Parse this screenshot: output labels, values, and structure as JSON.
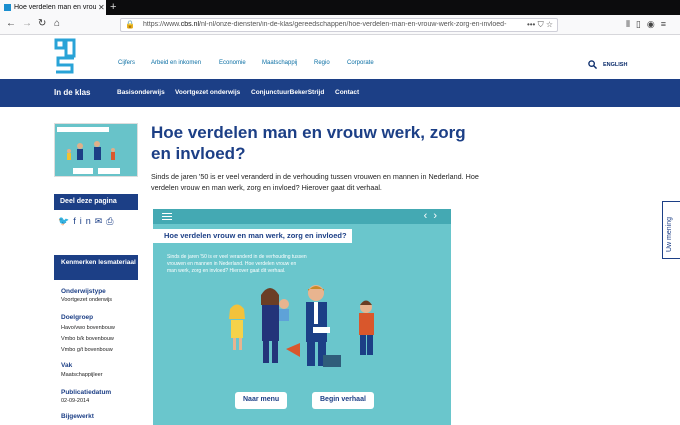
{
  "browser": {
    "tab_title": "Hoe verdelen man en vrouw wer",
    "url_prefix": "https://www.",
    "url_domain": "cbs.nl",
    "url_path": "/nl-nl/onze-diensten/in-de-klas/gereedschappen/hoe-verdelen-man-en-vrouw-werk-zorg-en-invloed-",
    "url_more": "•••"
  },
  "header": {
    "nav": [
      "Cijfers",
      "Arbeid en inkomen",
      "Economie",
      "Maatschappij",
      "Regio",
      "Corporate"
    ],
    "english": "ENGLISH"
  },
  "subnav": {
    "section": "In de klas",
    "items": [
      "Basisonderwijs",
      "Voortgezet onderwijs",
      "ConjunctuurBekerStrijd",
      "Contact"
    ]
  },
  "sidebar": {
    "share_label": "Deel deze pagina",
    "kenmerken_label": "Kenmerken lesmateriaal",
    "meta": [
      {
        "label": "Onderwijstype",
        "value": "Voortgezet onderwijs"
      },
      {
        "label": "Doelgroep",
        "value": "Havo/vwo bovenbouw\nVmbo b/k bovenbouw\nVmbo g/t bovenbouw"
      },
      {
        "label": "Vak",
        "value": "Maatschappijleer"
      },
      {
        "label": "Publicatiedatum",
        "value": "02-09-2014"
      },
      {
        "label": "Bijgewerkt",
        "value": ""
      }
    ]
  },
  "main": {
    "title": "Hoe verdelen man en vrouw werk, zorg en invloed?",
    "intro": "Sinds de jaren '50 is er veel veranderd in de verhouding tussen vrouwen en mannen in Nederland. Hoe verdelen vrouw en man werk, zorg en invloed? Hierover gaat dit verhaal."
  },
  "video": {
    "title": "Hoe verdelen vrouw en man werk, zorg en invloed?",
    "text": "Sinds de jaren '50 is er veel veranderd in de verhouding tussen vrouwen en mannen in Nederland. Hoe verdelen vrouw en man werk, zorg en invloed? Hierover gaat dit verhaal.",
    "btn_menu": "Naar menu",
    "btn_start": "Begin verhaal"
  },
  "feedback": "Uw mening",
  "colors": {
    "brand": "#1c3f86",
    "teal": "#6ac6cc",
    "link": "#0b6fa4"
  }
}
